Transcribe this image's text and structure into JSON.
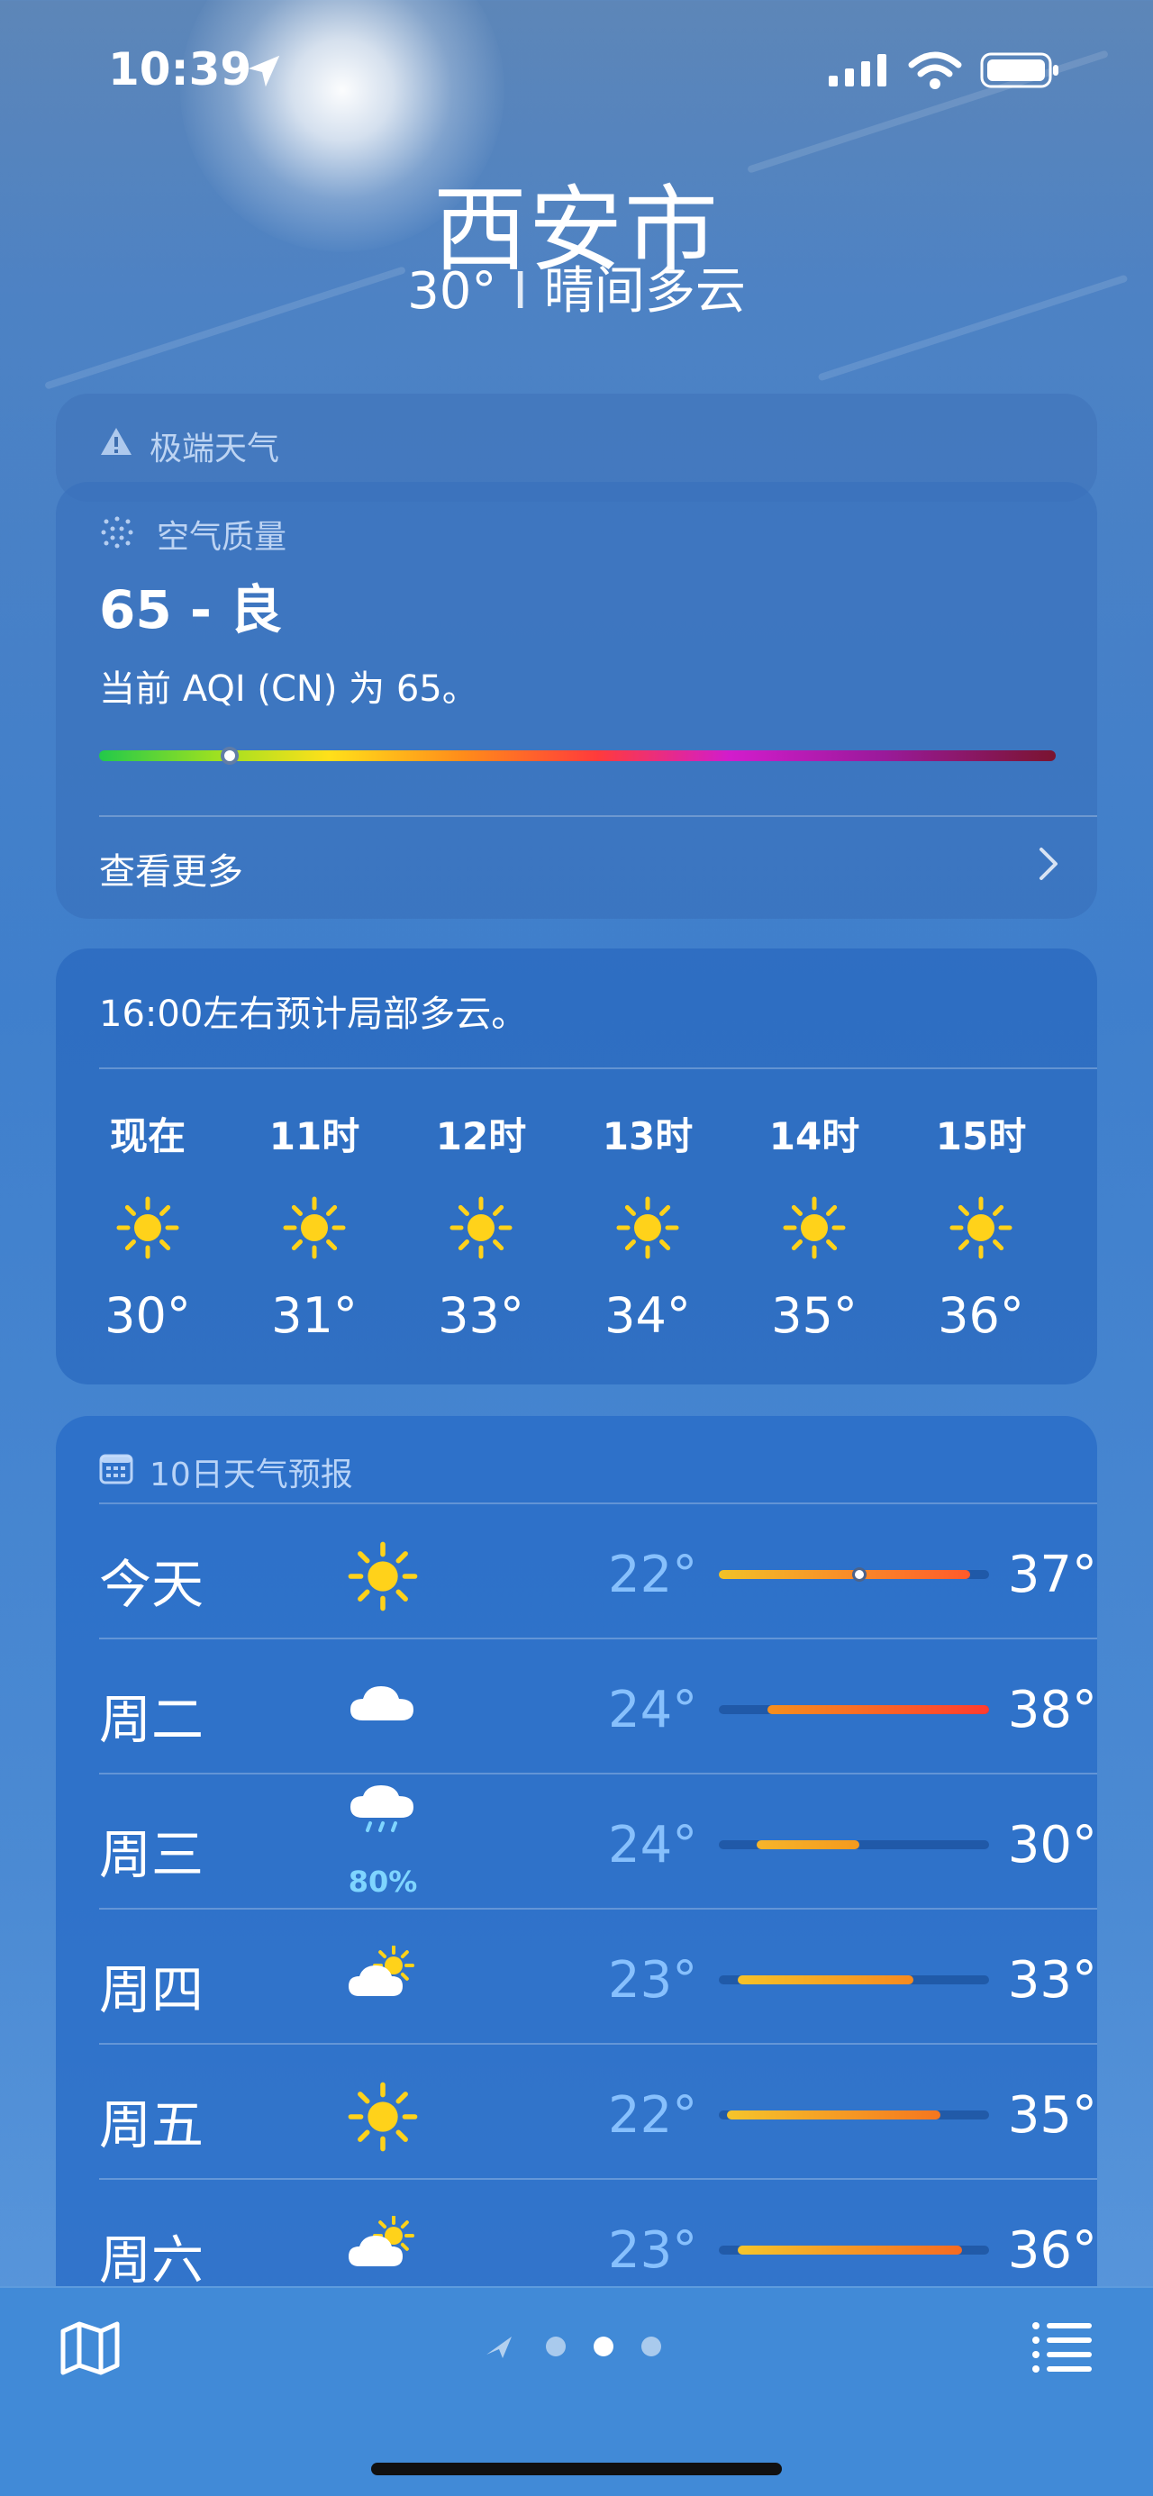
{
  "status_bar": {
    "time": "10:39"
  },
  "header": {
    "city": "西安市",
    "temperature": "30°",
    "separator": "I",
    "condition": "晴间多云"
  },
  "extreme_weather": {
    "title": "极端天气",
    "icon": "warning-icon"
  },
  "air_quality": {
    "title": "空气质量",
    "value": "65 - 良",
    "description": "当前 AQI (CN) 为 65。",
    "aqi": 65,
    "bar_position_fraction": 0.135,
    "see_more": "查看更多"
  },
  "hourly": {
    "note": "16:00左右预计局部多云。",
    "items": [
      {
        "label": "现在",
        "temp": "30°",
        "icon": "sun-icon"
      },
      {
        "label": "11时",
        "temp": "31°",
        "icon": "sun-icon"
      },
      {
        "label": "12时",
        "temp": "33°",
        "icon": "sun-icon"
      },
      {
        "label": "13时",
        "temp": "34°",
        "icon": "sun-icon"
      },
      {
        "label": "14时",
        "temp": "35°",
        "icon": "sun-icon"
      },
      {
        "label": "15时",
        "temp": "36°",
        "icon": "sun-icon"
      }
    ]
  },
  "daily": {
    "title": "10日天气预报",
    "range_fraction_note_units": "fraction of shared temperature scale",
    "days": [
      {
        "name": "今天",
        "icon": "sun-icon",
        "low": "22°",
        "high": "37°",
        "fill_start": 0.0,
        "fill_end": 0.93,
        "now": 0.51,
        "colors": [
          "#f2c227",
          "#ff5a2a"
        ]
      },
      {
        "name": "周二",
        "icon": "cloud-icon",
        "low": "24°",
        "high": "38°",
        "fill_start": 0.18,
        "fill_end": 1.0,
        "colors": [
          "#f68f1d",
          "#ff3b2f"
        ]
      },
      {
        "name": "周三",
        "icon": "cloud-rain-icon",
        "precip": "80%",
        "low": "24°",
        "high": "30°",
        "fill_start": 0.14,
        "fill_end": 0.52,
        "colors": [
          "#f7b52a",
          "#f59a1e"
        ]
      },
      {
        "name": "周四",
        "icon": "partly-cloudy-icon",
        "low": "23°",
        "high": "33°",
        "fill_start": 0.07,
        "fill_end": 0.72,
        "colors": [
          "#f6c229",
          "#f68a1f"
        ]
      },
      {
        "name": "周五",
        "icon": "sun-icon",
        "low": "22°",
        "high": "35°",
        "fill_start": 0.03,
        "fill_end": 0.82,
        "colors": [
          "#f5c52b",
          "#f5761e"
        ]
      },
      {
        "name": "周六",
        "icon": "partly-cloudy-icon",
        "low": "23°",
        "high": "36°",
        "fill_start": 0.07,
        "fill_end": 0.9,
        "colors": [
          "#f5c52b",
          "#f56a22"
        ]
      }
    ]
  },
  "bottom": {
    "map_icon": "map-icon",
    "list_icon": "list-icon",
    "location_icon": "location-arrow-icon"
  }
}
